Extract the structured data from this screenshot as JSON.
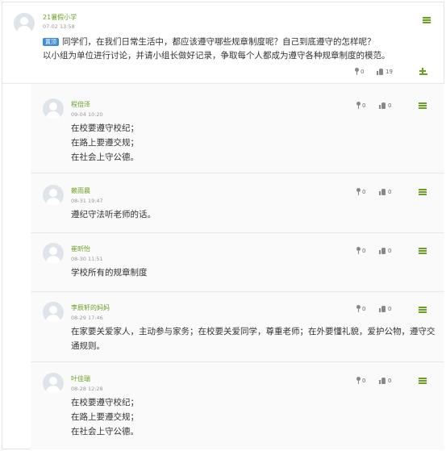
{
  "post": {
    "author": "21暑假小学",
    "time": "07-02 13:58",
    "badge": "置顶",
    "line1": "同学们，在我们日常生活中，都应该遵守哪些规章制度呢？自己到底遵守的怎样呢？",
    "line2": "以小组为单位进行讨论，并请小组长做好记录，争取每个人都成为遵守各种规章制度的模范。",
    "flower_count": "0",
    "like_count": "19",
    "flower_icon": "flower-icon",
    "like_icon": "thumbs-up-icon",
    "reply_icon": "reply-icon",
    "menu_icon": "menu-icon"
  },
  "replies": [
    {
      "author": "程倍泽",
      "time": "09-04 10:20",
      "flowers": "0",
      "likes": "0",
      "lines": [
        "在校要遵守校纪；",
        "在路上要遵交规；",
        "在社会上守公德。"
      ]
    },
    {
      "author": "赖雨晨",
      "time": "08-31 19:47",
      "flowers": "0",
      "likes": "0",
      "lines": [
        "遵纪守法听老师的话。"
      ]
    },
    {
      "author": "崔昕怡",
      "time": "08-30 11:51",
      "flowers": "0",
      "likes": "0",
      "lines": [
        "学校所有的规章制度"
      ]
    },
    {
      "author": "李辰轩的妈妈",
      "time": "08-29 17:46",
      "flowers": "0",
      "likes": "0",
      "lines": [
        "在家要关爱家人，主动参与家务；在校要关爱同学，尊重老师；在外要懂礼貌，爱护公物，遵守交",
        "通规则。"
      ]
    },
    {
      "author": "叶佳瑞",
      "time": "08-28 12:28",
      "flowers": "0",
      "likes": "0",
      "lines": [
        "在校要遵守校纪；",
        "在路上要遵交规；",
        "在社会上守公德。"
      ]
    }
  ],
  "colors": {
    "accent": "#6aa121",
    "badge": "#3e8ed9",
    "text": "#333333",
    "meta": "#999999"
  }
}
